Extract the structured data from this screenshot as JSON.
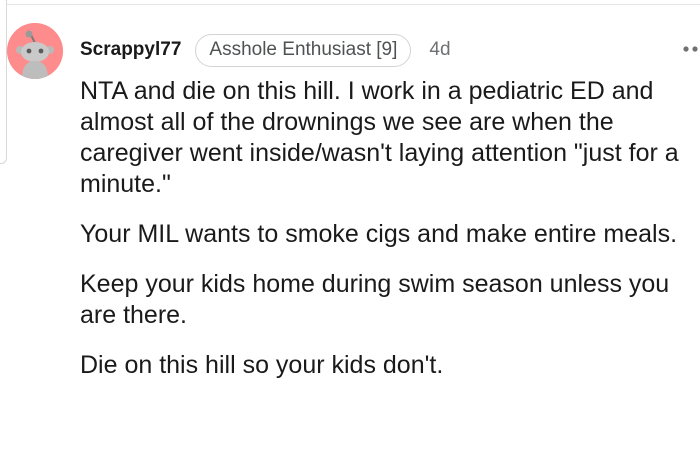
{
  "comment": {
    "username": "Scrappyl77",
    "flair": "Asshole Enthusiast [9]",
    "age": "4d",
    "more_icon": "more-horizontal-icon",
    "avatar_icon": "snoo-avatar-icon",
    "avatar_color": "#ff8c8c",
    "paragraphs": [
      "NTA and die on this hill. I work in a pediatric ED and almost all of the drownings we see are when the caregiver went inside/wasn't laying attention \"just for a minute.\"",
      "Your MIL wants to smoke cigs and make entire meals.",
      "Keep your kids home during swim season unless you are there.",
      "Die on this hill so your kids don't."
    ]
  }
}
